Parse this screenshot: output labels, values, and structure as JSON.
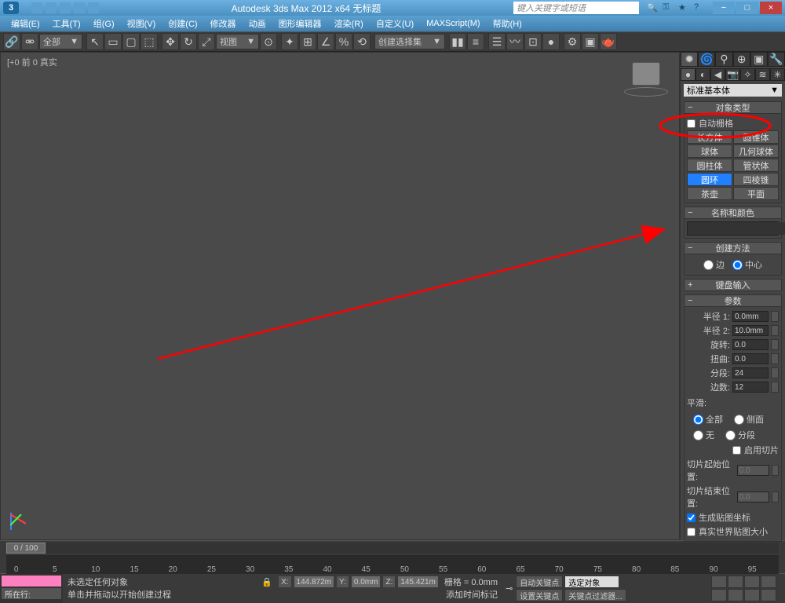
{
  "titlebar": {
    "title": "Autodesk 3ds Max 2012 x64   无标题",
    "search_placeholder": "键入关键字或短语"
  },
  "menu": [
    "编辑(E)",
    "工具(T)",
    "组(G)",
    "视图(V)",
    "创建(C)",
    "修改器",
    "动画",
    "图形编辑器",
    "渲染(R)",
    "自定义(U)",
    "MAXScript(M)",
    "帮助(H)"
  ],
  "toolbar": {
    "selset": "全部",
    "view": "视图",
    "sel_filter": "创建选择集"
  },
  "viewport": {
    "label": "[+0 前 0 真实"
  },
  "cmd": {
    "dropdown": "标准基本体",
    "rollouts": {
      "objtype": "对象类型",
      "autogrid": "自动栅格",
      "objects": [
        "长方体",
        "圆锥体",
        "球体",
        "几何球体",
        "圆柱体",
        "管状体",
        "圆环",
        "四棱锥",
        "茶壶",
        "平面"
      ],
      "namecolor": "名称和颜色",
      "creation": "创建方法",
      "edge": "边",
      "center": "中心",
      "kbentry": "键盘输入",
      "params": "参数",
      "r1": "半径 1:",
      "r1v": "0.0mm",
      "r2": "半径 2:",
      "r2v": "10.0mm",
      "rot": "旋转:",
      "rotv": "0.0",
      "twist": "扭曲:",
      "twistv": "0.0",
      "segs": "分段:",
      "segsv": "24",
      "sides": "边数:",
      "sidesv": "12",
      "smooth": "平滑:",
      "all": "全部",
      "side": "侧面",
      "none": "无",
      "seg": "分段",
      "slice": "启用切片",
      "sfrom": "切片起始位置:",
      "sfromv": "0.0",
      "sto": "切片结束位置:",
      "stov": "0.0",
      "genmap": "生成贴图坐标",
      "realworld": "真实世界贴图大小"
    }
  },
  "timeline": {
    "range": "0 / 100"
  },
  "status": {
    "now": "所在行:",
    "nosel": "未选定任何对象",
    "hint": "单击并拖动以开始创建过程",
    "addtime": "添加时间标记",
    "x": "X:",
    "xv": "144.872m",
    "y": "Y:",
    "yv": "0.0mm",
    "z": "Z:",
    "zv": "145.421m",
    "grid": "栅格 = 0.0mm",
    "autokey": "自动关键点",
    "selobj": "选定对象",
    "setkey": "设置关键点",
    "keyfilter": "关键点过滤器..."
  }
}
